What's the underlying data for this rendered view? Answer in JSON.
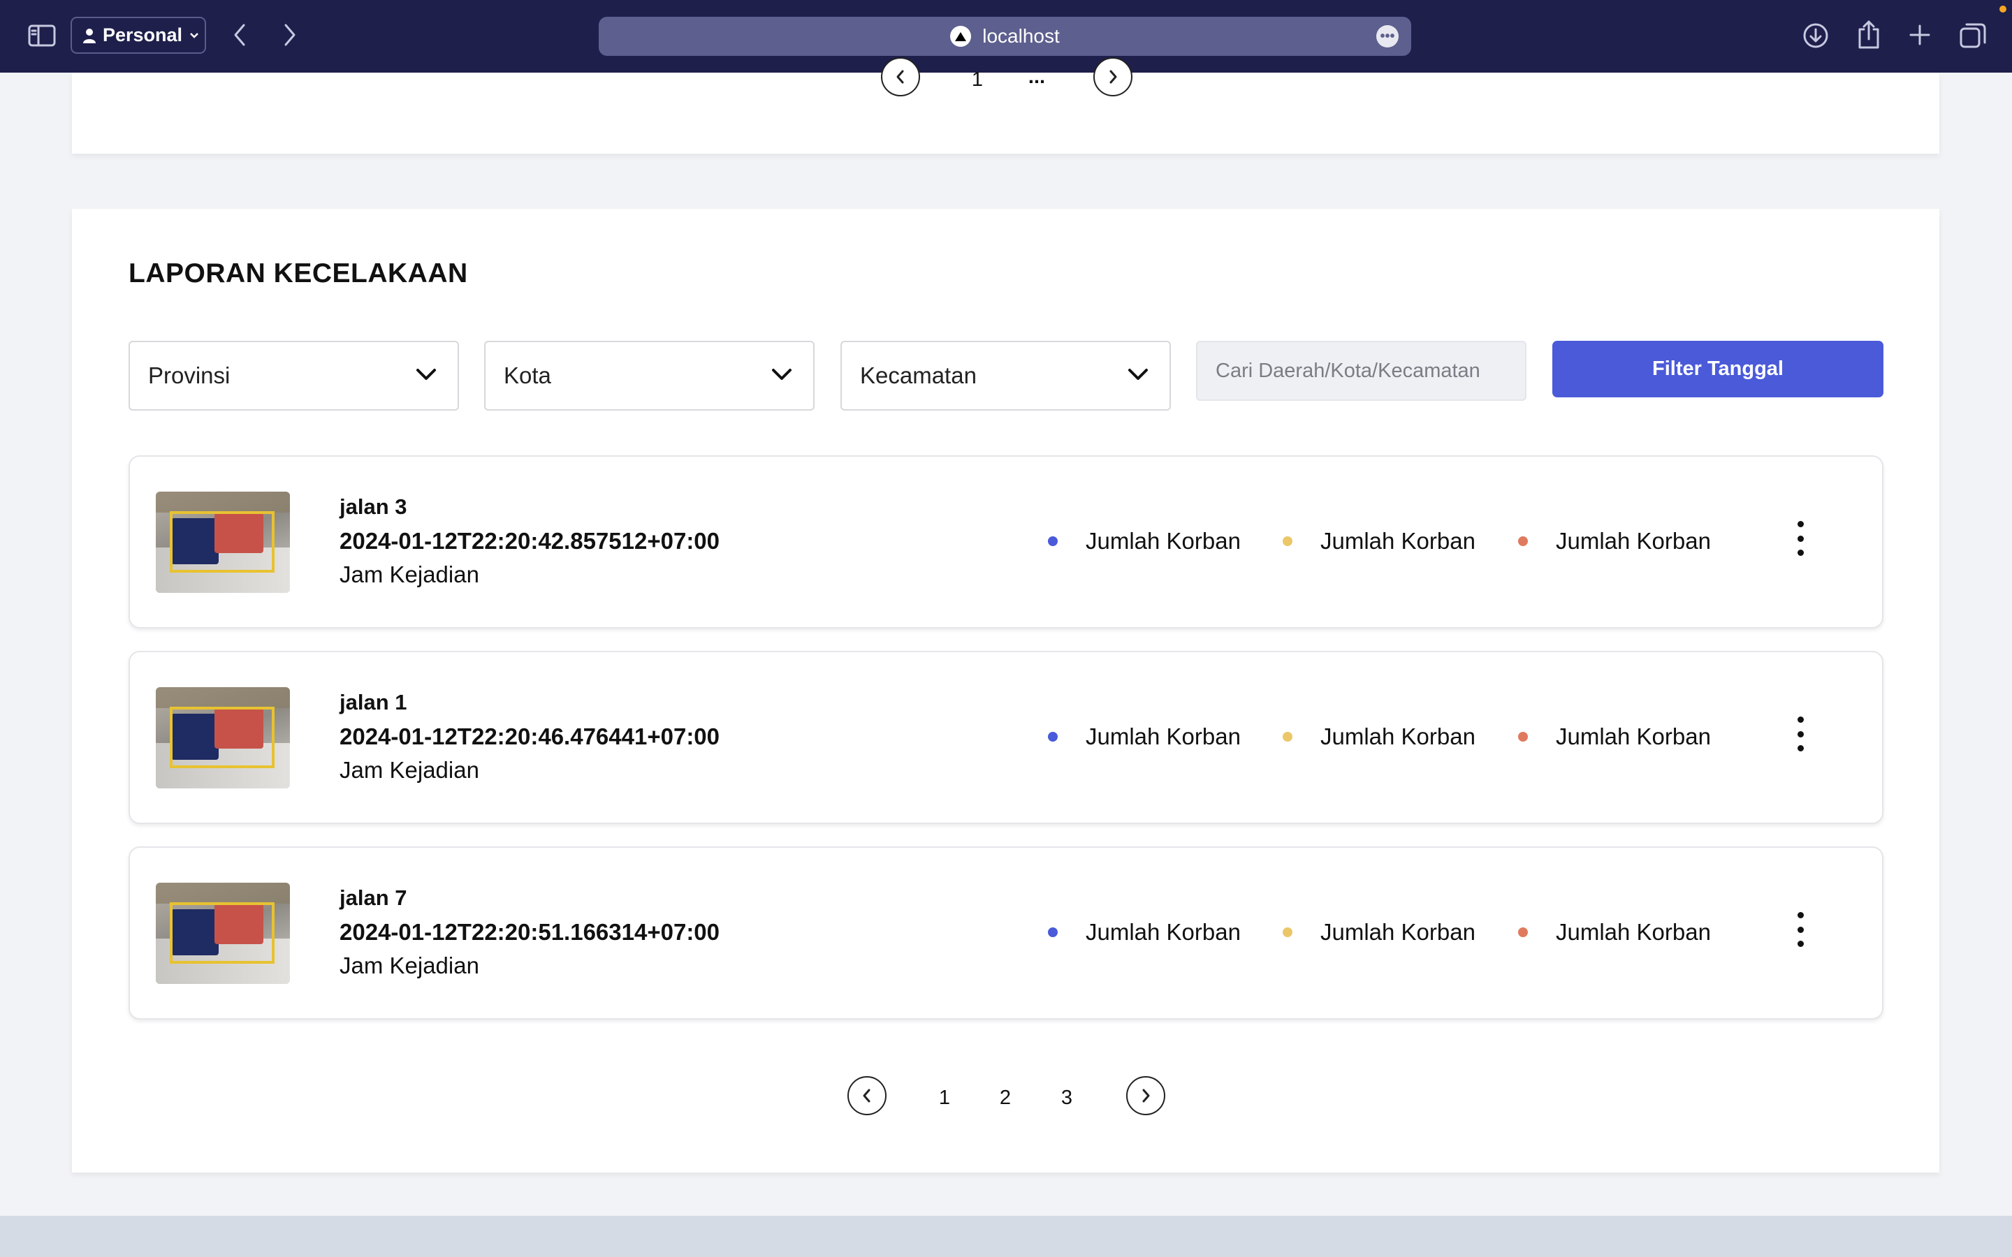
{
  "browser": {
    "profile_label": "Personal",
    "url": "localhost",
    "icons": [
      "sidebar-icon",
      "person-icon",
      "back-icon",
      "forward-icon",
      "site-logo-icon",
      "more-icon",
      "download-icon",
      "share-icon",
      "new-tab-icon",
      "tabs-overview-icon"
    ]
  },
  "top_pagination": {
    "pages": [
      "1"
    ],
    "ellipsis": "..."
  },
  "section": {
    "title": "LAPORAN KECELAKAAN"
  },
  "filters": {
    "provinsi": "Provinsi",
    "kota": "Kota",
    "kecamatan": "Kecamatan",
    "search_placeholder": "Cari Daerah/Kota/Kecamatan",
    "filter_button": "Filter Tanggal"
  },
  "reports": [
    {
      "name": "jalan 3",
      "timestamp": "2024-01-12T22:20:42.857512+07:00",
      "subtitle": "Jam Kejadian",
      "stats": [
        "Jumlah Korban",
        "Jumlah Korban",
        "Jumlah Korban"
      ]
    },
    {
      "name": "jalan 1",
      "timestamp": "2024-01-12T22:20:46.476441+07:00",
      "subtitle": "Jam Kejadian",
      "stats": [
        "Jumlah Korban",
        "Jumlah Korban",
        "Jumlah Korban"
      ]
    },
    {
      "name": "jalan 7",
      "timestamp": "2024-01-12T22:20:51.166314+07:00",
      "subtitle": "Jam Kejadian",
      "stats": [
        "Jumlah Korban",
        "Jumlah Korban",
        "Jumlah Korban"
      ]
    }
  ],
  "stat_colors": [
    "#4a5ad9",
    "#ebc76a",
    "#e07a5f"
  ],
  "pagination": {
    "pages": [
      "1",
      "2",
      "3"
    ]
  },
  "colors": {
    "toolbar": "#1e1f4b",
    "primary": "#4a5ad9"
  }
}
